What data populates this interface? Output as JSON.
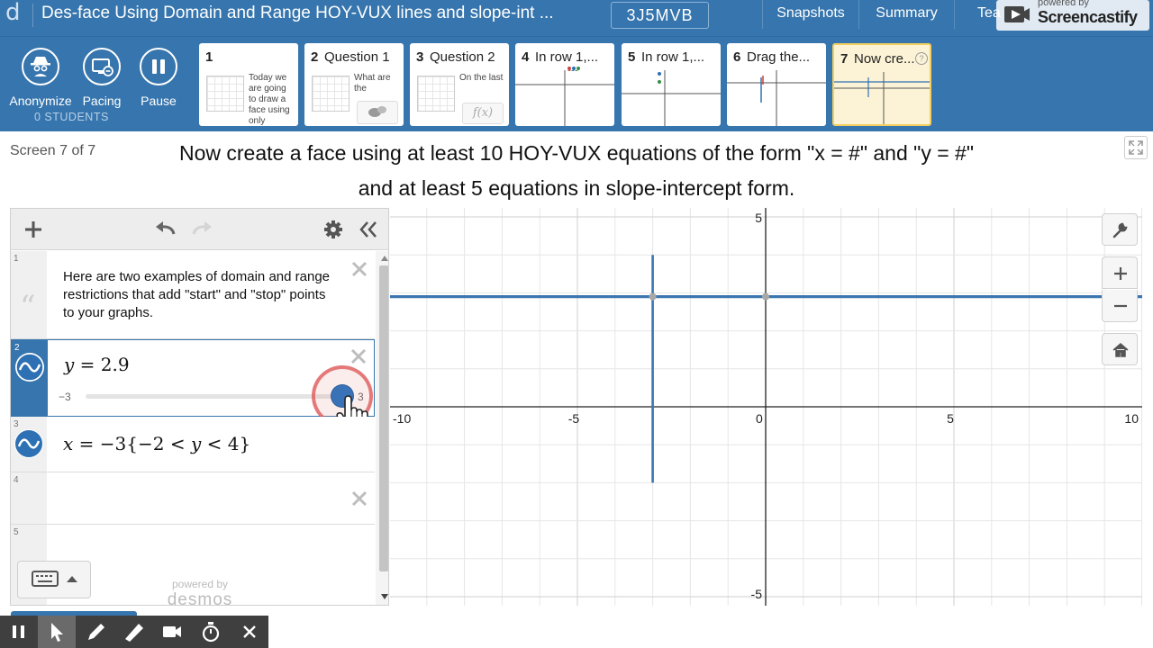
{
  "header": {
    "logo_glyph": "d",
    "activity_title": "Des-face Using Domain and Range HOY-VUX lines and slope-int ...",
    "class_code": "3J5MVB",
    "tabs": [
      "Snapshots",
      "Summary",
      "Tea"
    ]
  },
  "watermark": {
    "line1": "powered by",
    "line2": "Screencastify"
  },
  "dashboard": {
    "controls": [
      {
        "label": "Anonymize",
        "icon": "spy-icon"
      },
      {
        "label": "Pacing",
        "icon": "pacing-icon"
      },
      {
        "label": "Pause",
        "icon": "pause-icon"
      }
    ],
    "student_count": "0 STUDENTS",
    "screens": [
      {
        "num": "1",
        "title": "",
        "desc": "Today we are going to draw a face using only"
      },
      {
        "num": "2",
        "title": "Question 1",
        "desc": "What are the"
      },
      {
        "num": "3",
        "title": "Question 2",
        "desc": "On the last",
        "badge": "f(x)"
      },
      {
        "num": "4",
        "title": "In row 1,...",
        "desc": ""
      },
      {
        "num": "5",
        "title": "In row 1,...",
        "desc": ""
      },
      {
        "num": "6",
        "title": "Drag the...",
        "desc": ""
      },
      {
        "num": "7",
        "title": "Now cre...",
        "desc": ""
      }
    ]
  },
  "screen": {
    "counter": "Screen 7 of 7",
    "prompt_line1": "Now create a face using at least 10 HOY-VUX equations of the form \"x = #\" and \"y = #\"",
    "prompt_line2": "and at least 5 equations in slope-intercept form."
  },
  "expressions": {
    "rows": [
      {
        "num": "1",
        "type": "note",
        "text": "Here are two examples of domain and range restrictions that add \"start\" and \"stop\" points to your graphs."
      },
      {
        "num": "2",
        "type": "expression",
        "latex_var": "y",
        "latex_rest": " = 2.9",
        "slider_min": "−3",
        "slider_max": "3",
        "slider_value_fraction": 0.98
      },
      {
        "num": "3",
        "type": "expression",
        "latex_var": "x",
        "latex_mid": " = −3",
        "latex_restriction": "{−2 < ",
        "latex_restriction_var": "y",
        "latex_restriction_end": " < 4}"
      },
      {
        "num": "4",
        "type": "empty"
      },
      {
        "num": "5",
        "type": "empty"
      }
    ],
    "powered_by": "powered by",
    "brand": "desmos"
  },
  "graph": {
    "x_ticks": [
      "-10",
      "-5",
      "0",
      "5",
      "10"
    ],
    "y_ticks": [
      "5",
      "-5"
    ],
    "line_color": "#3b76b0"
  },
  "chart_data": {
    "type": "line",
    "xlim": [
      -10,
      10
    ],
    "ylim": [
      -5,
      5
    ],
    "grid": true,
    "series": [
      {
        "name": "",
        "equation": "y = 2.9",
        "points": [
          [
            -10,
            2.9
          ],
          [
            10,
            2.9
          ]
        ]
      },
      {
        "name": "",
        "equation": "x = -3 {-2 < y < 4}",
        "points": [
          [
            -3,
            -2
          ],
          [
            -3,
            4
          ]
        ]
      }
    ],
    "marked_points": [
      [
        -3,
        2.9
      ],
      [
        0,
        2.9
      ]
    ]
  },
  "colors": {
    "brand_blue": "#3675ad",
    "graph_blue": "#3b76b0",
    "current_screen": "#fcf3d6"
  }
}
